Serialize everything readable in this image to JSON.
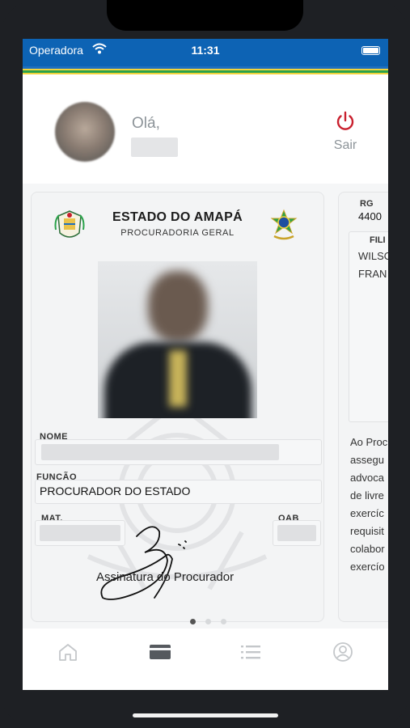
{
  "status_bar": {
    "carrier": "Operadora",
    "time": "11:31"
  },
  "colors": {
    "status_bar_bg": "#0d63b4",
    "stripe_blue": "#1f6fc0",
    "stripe_yellow": "#f2d33b",
    "stripe_green": "#2aa24a",
    "logout_red": "#c9202e"
  },
  "header": {
    "greeting": "Olá,",
    "logout_label": "Sair"
  },
  "card": {
    "title": "ESTADO DO AMAPÁ",
    "subtitle": "PROCURADORIA GERAL",
    "fields": {
      "nome_label": "NOME",
      "funcao_label": "FUNÇÃO",
      "funcao_value": "PROCURADOR DO ESTADO",
      "mat_label": "MAT.",
      "oab_label": "OAB"
    },
    "signature_caption": "Assinatura do Procurador"
  },
  "card_back": {
    "rg_label": "RG",
    "rg_value": "4400",
    "filiacao_label": "FILI",
    "filiacao_lines": [
      "WILSO",
      "FRAN"
    ],
    "paragraph_lines": [
      "Ao Proc",
      "assegu",
      "advoca",
      "de livre",
      "exercíc",
      "requisit",
      "colabor",
      "exercío"
    ]
  },
  "pager": {
    "count": 3,
    "active_index": 0
  },
  "tabbar": {
    "tabs": [
      {
        "icon": "home-icon",
        "active": false
      },
      {
        "icon": "id-card-icon",
        "active": true
      },
      {
        "icon": "list-icon",
        "active": false
      },
      {
        "icon": "user-icon",
        "active": false
      }
    ]
  }
}
